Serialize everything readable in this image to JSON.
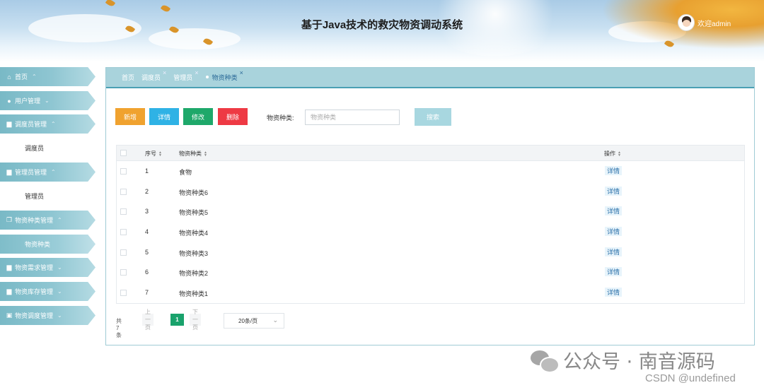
{
  "header": {
    "title": "基于Java技术的救灾物资调动系统",
    "welcome": "欢迎admin"
  },
  "sidebar": {
    "items": [
      {
        "label": "首页",
        "icon": "home-icon",
        "chevron": "^"
      },
      {
        "label": "用户管理",
        "icon": "user-icon",
        "chevron": "v"
      },
      {
        "label": "调度员管理",
        "icon": "folder-icon",
        "chevron": "^"
      },
      {
        "label": "调度员",
        "sub": true
      },
      {
        "label": "管理员管理",
        "icon": "folder-icon",
        "chevron": "^"
      },
      {
        "label": "管理员",
        "sub": true
      },
      {
        "label": "物资种类管理",
        "icon": "copy-icon",
        "chevron": "^"
      },
      {
        "label": "物资种类",
        "sub": true,
        "active": true
      },
      {
        "label": "物资需求管理",
        "icon": "printer-icon",
        "chevron": "v"
      },
      {
        "label": "物资库存管理",
        "icon": "folder-icon",
        "chevron": "v"
      },
      {
        "label": "物资调度管理",
        "icon": "doc-icon",
        "chevron": "v"
      }
    ]
  },
  "tabs": [
    {
      "label": "首页",
      "closable": false
    },
    {
      "label": "调度员",
      "closable": true
    },
    {
      "label": "管理员",
      "closable": true
    },
    {
      "label": "物资种类",
      "closable": true,
      "active": true
    }
  ],
  "toolbar": {
    "add": "新增",
    "detail": "详情",
    "edit": "修改",
    "delete": "删除",
    "search_label": "物资种类:",
    "search_placeholder": "物资种类",
    "search_button": "搜索"
  },
  "table": {
    "columns": [
      "序号",
      "物资种类",
      "操作"
    ],
    "rows": [
      {
        "no": "1",
        "name": "食物",
        "action": "详情"
      },
      {
        "no": "2",
        "name": "物资种类6",
        "action": "详情"
      },
      {
        "no": "3",
        "name": "物资种类5",
        "action": "详情"
      },
      {
        "no": "4",
        "name": "物资种类4",
        "action": "详情"
      },
      {
        "no": "5",
        "name": "物资种类3",
        "action": "详情"
      },
      {
        "no": "6",
        "name": "物资种类2",
        "action": "详情"
      },
      {
        "no": "7",
        "name": "物资种类1",
        "action": "详情"
      }
    ]
  },
  "pagination": {
    "total": "共 7 条",
    "prev": "上一页",
    "current": "1",
    "next": "下一页",
    "page_size": "20条/页"
  },
  "watermark": {
    "line1": "公众号 · 南音源码",
    "line2": "CSDN @undefined"
  },
  "colors": {
    "add": "#f0a22f",
    "detail": "#2fb2e5",
    "edit": "#1ea86a",
    "delete": "#ee3a44",
    "accent": "#79b9c6",
    "pager_active": "#19a26c"
  }
}
